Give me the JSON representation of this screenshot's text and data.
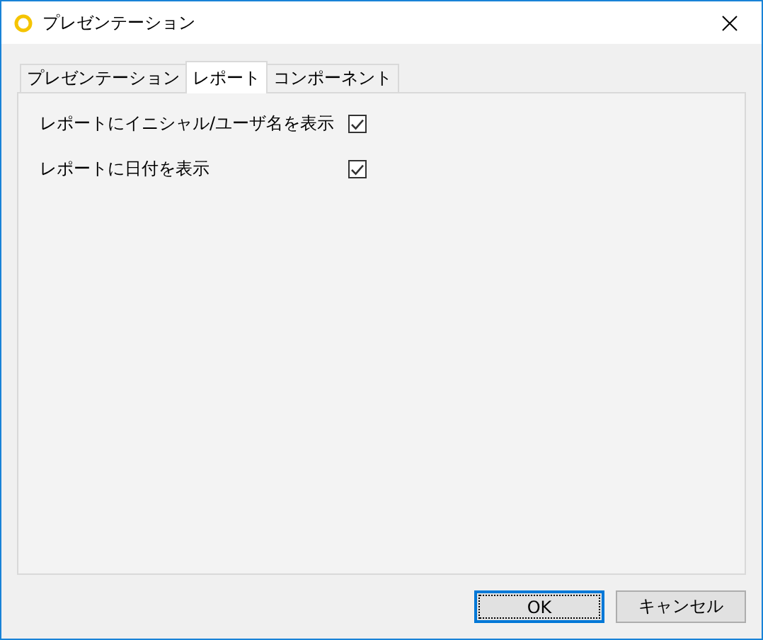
{
  "window": {
    "title": "プレゼンテーション"
  },
  "tabs": [
    {
      "label": "プレゼンテーション",
      "selected": false
    },
    {
      "label": "レポート",
      "selected": true
    },
    {
      "label": "コンポーネント",
      "selected": false
    }
  ],
  "options": [
    {
      "label": "レポートにイニシャル/ユーザ名を表示",
      "checked": true
    },
    {
      "label": "レポートに日付を表示",
      "checked": true
    }
  ],
  "buttons": [
    {
      "label": "OK",
      "default": true
    },
    {
      "label": "キャンセル",
      "default": false
    }
  ]
}
